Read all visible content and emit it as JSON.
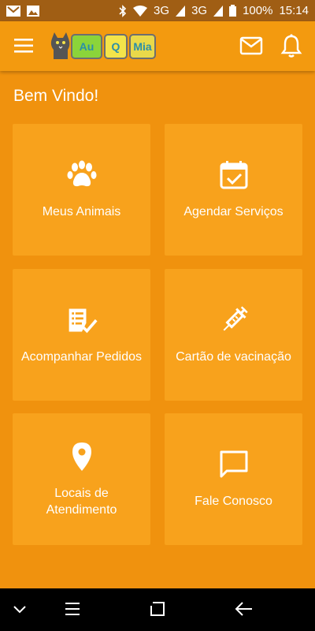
{
  "status_bar": {
    "network_1": "3G",
    "network_2": "3G",
    "battery": "100%",
    "time": "15:14"
  },
  "app_bar": {
    "logo_text": {
      "part1": "Au",
      "part2": "Q",
      "part3": "Mia"
    }
  },
  "main": {
    "welcome": "Bem Vindo!",
    "tiles": [
      {
        "label": "Meus Animais",
        "icon": "paw-icon"
      },
      {
        "label": "Agendar Serviços",
        "icon": "calendar-check-icon"
      },
      {
        "label": "Acompanhar Pedidos",
        "icon": "checklist-icon"
      },
      {
        "label": "Cartão de vacinação",
        "icon": "syringe-icon"
      },
      {
        "label": "Locais de\nAtendimento",
        "icon": "location-pin-icon"
      },
      {
        "label": "Fale Conosco",
        "icon": "chat-bubble-icon"
      }
    ]
  },
  "colors": {
    "background": "#F0920E",
    "app_bar": "#F39A0F",
    "tile": "#F8A21C",
    "status_bar": "#A05E14"
  }
}
